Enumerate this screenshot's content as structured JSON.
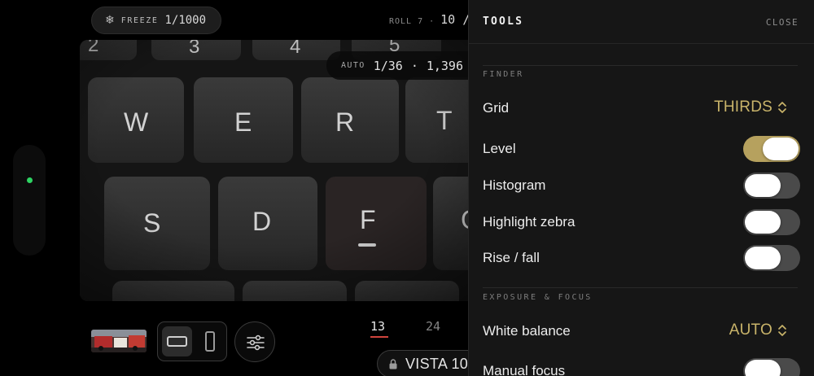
{
  "camera": {
    "freeze": {
      "icon": "snowflake-icon",
      "label": "FREEZE",
      "value": "1/1000"
    },
    "roll": {
      "label": "ROLL 7",
      "separator": "·",
      "count": "10 /"
    },
    "exposure": {
      "mode": "AUTO",
      "shutter": "1/36",
      "separator": "·",
      "iso": "1,396"
    },
    "focal_lengths": [
      {
        "label": "13",
        "selected": true
      },
      {
        "label": "24",
        "selected": false
      }
    ],
    "film": {
      "icon": "lock-icon",
      "label": "VISTA 10"
    },
    "aspect": {
      "options": [
        "landscape",
        "portrait"
      ],
      "selected": "landscape"
    },
    "colors": {
      "accent_red": "#d0443d",
      "status_green": "#2ed463"
    }
  },
  "tools": {
    "title": "TOOLS",
    "close_label": "CLOSE",
    "accent": "#c9b46a",
    "finder": {
      "title": "FINDER",
      "grid": {
        "label": "Grid",
        "value": "THIRDS"
      },
      "level": {
        "label": "Level",
        "on": true
      },
      "histogram": {
        "label": "Histogram",
        "on": false
      },
      "highlight_zebra": {
        "label": "Highlight zebra",
        "on": false
      },
      "rise_fall": {
        "label": "Rise / fall",
        "on": false
      }
    },
    "exposure_focus": {
      "title": "EXPOSURE & FOCUS",
      "white_balance": {
        "label": "White balance",
        "value": "AUTO"
      },
      "manual_focus": {
        "label": "Manual focus",
        "on": false
      }
    }
  }
}
